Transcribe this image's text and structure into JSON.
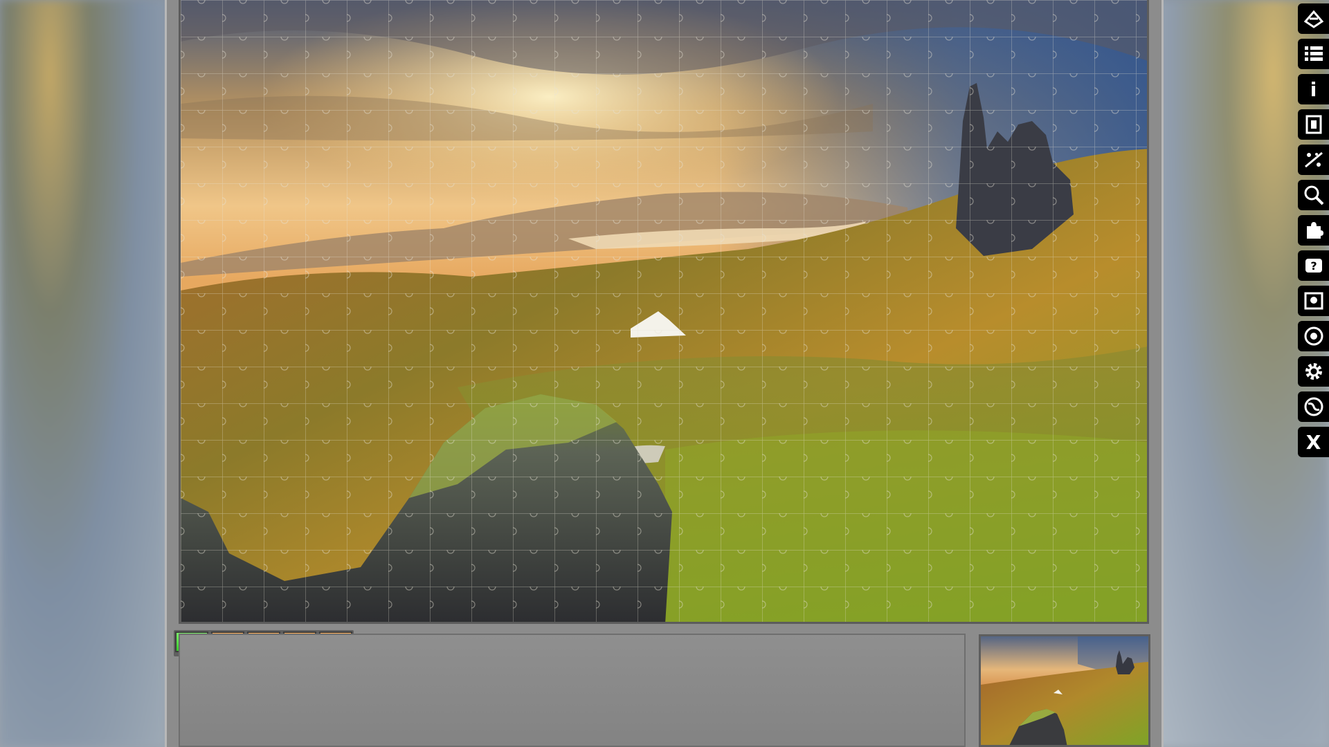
{
  "counters": [
    {
      "value": "0",
      "color": "#3dcc2f"
    },
    {
      "value": "0",
      "color": "#f5821e"
    },
    {
      "value": "0",
      "color": "#f5821e"
    },
    {
      "value": "0",
      "color": "#f5821e"
    },
    {
      "value": "0",
      "color": "#f5821e"
    }
  ],
  "toolbar": {
    "icons": [
      "shuffle-pieces-icon",
      "list-icon",
      "info-icon",
      "edge-pieces-icon",
      "scatter-icon",
      "zoom-icon",
      "puzzle-piece-icon",
      "help-icon",
      "screenshot-icon",
      "background-icon",
      "settings-icon",
      "globe-icon",
      "close-icon"
    ],
    "info_label": "i",
    "close_label": "X"
  },
  "colors": {
    "frame": "#8c8c8c",
    "tray": "#878787",
    "counter_green": "#3dcc2f",
    "counter_orange": "#f5821e",
    "toolbar_bg": "#000000"
  }
}
